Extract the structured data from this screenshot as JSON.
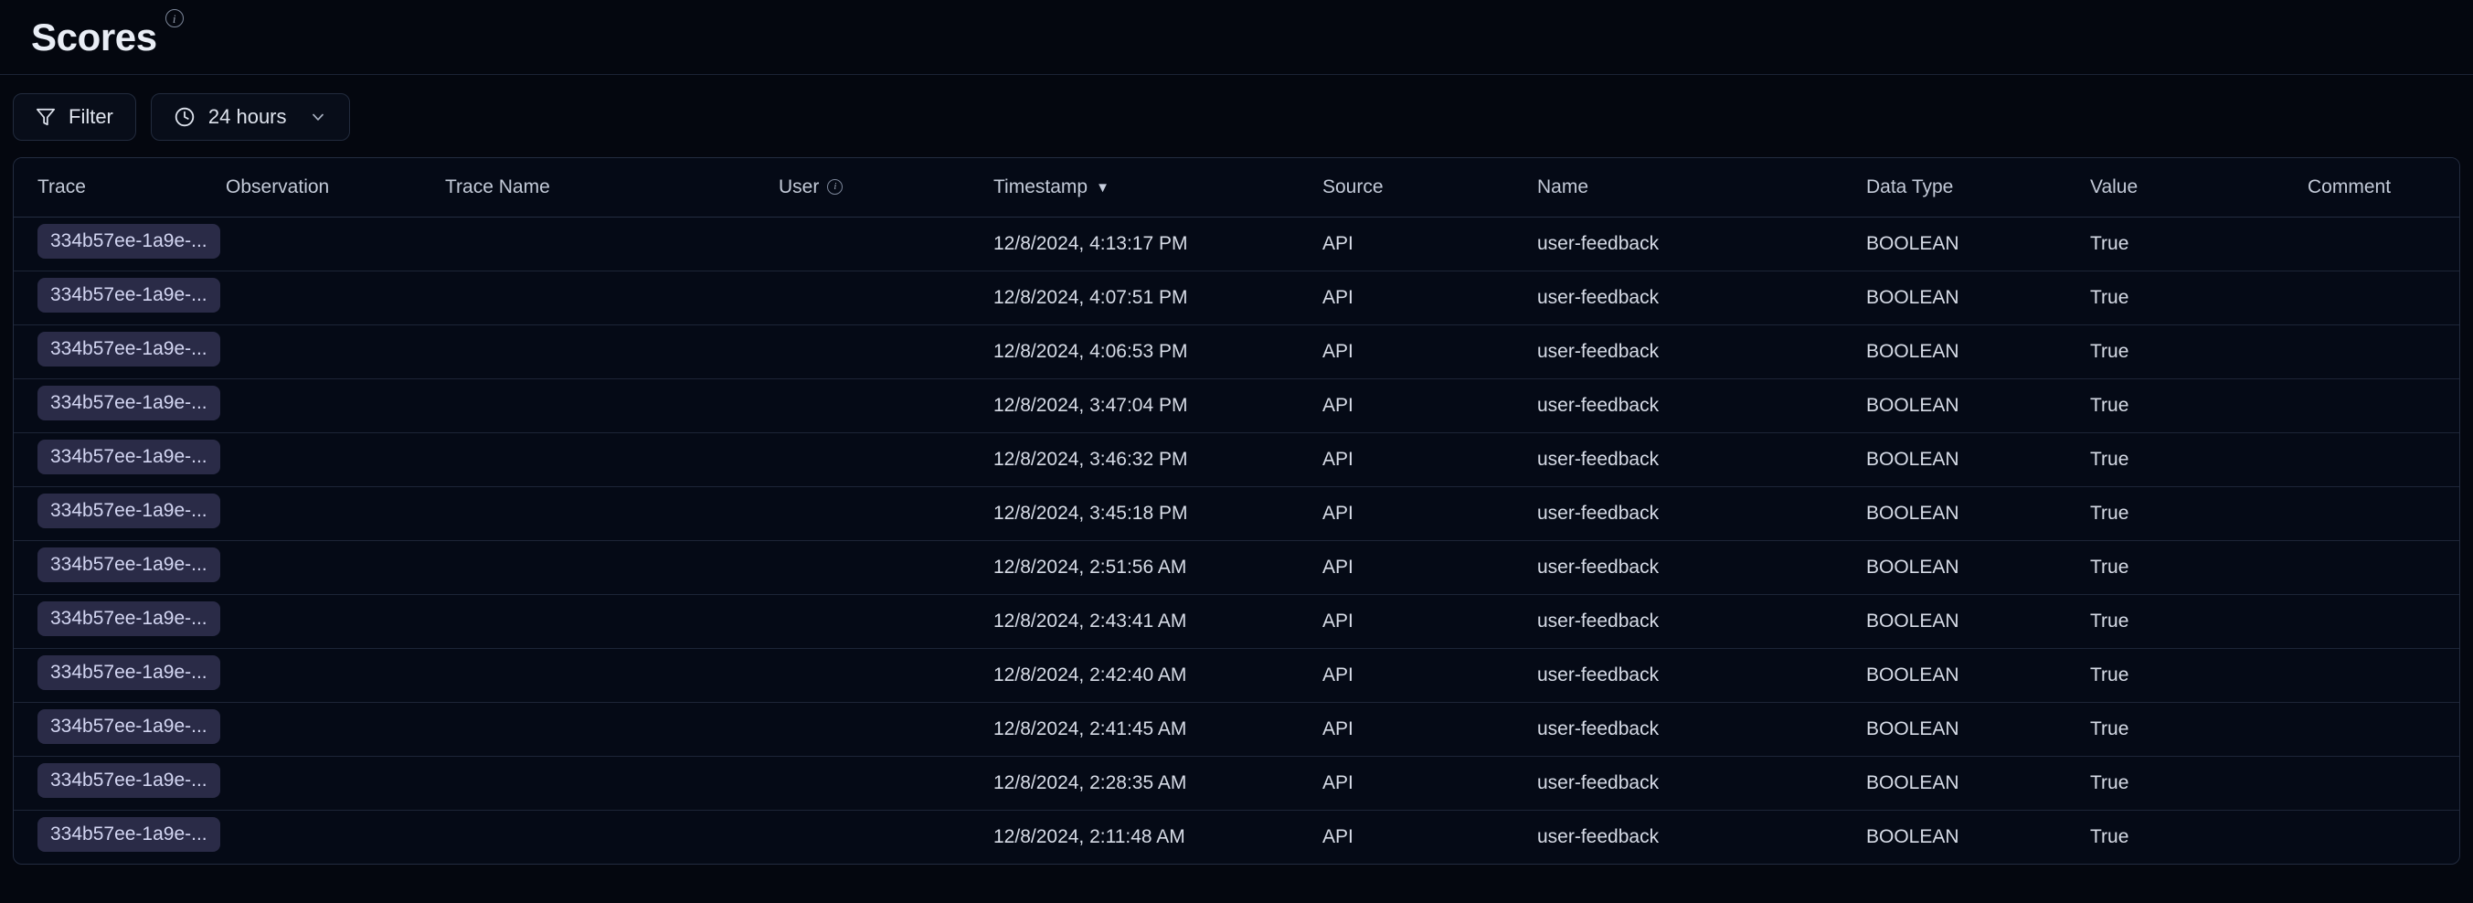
{
  "header": {
    "title": "Scores",
    "info_icon": "info-icon"
  },
  "toolbar": {
    "filter_label": "Filter",
    "filter_icon": "funnel-icon",
    "time_range_label": "24 hours",
    "time_range_icon": "clock-icon",
    "chevron_icon": "chevron-down-icon"
  },
  "table": {
    "columns": [
      {
        "key": "trace",
        "label": "Trace"
      },
      {
        "key": "observation",
        "label": "Observation"
      },
      {
        "key": "trace_name",
        "label": "Trace Name"
      },
      {
        "key": "user",
        "label": "User",
        "info_icon": "info-icon"
      },
      {
        "key": "timestamp",
        "label": "Timestamp",
        "sort": "desc",
        "sort_icon": "caret-down-icon"
      },
      {
        "key": "source",
        "label": "Source"
      },
      {
        "key": "name",
        "label": "Name"
      },
      {
        "key": "data_type",
        "label": "Data Type"
      },
      {
        "key": "value",
        "label": "Value"
      },
      {
        "key": "comment",
        "label": "Comment"
      }
    ],
    "rows": [
      {
        "trace": "334b57ee-1a9e-...",
        "observation": "",
        "trace_name": "",
        "user": "",
        "timestamp": "12/8/2024, 4:13:17 PM",
        "source": "API",
        "name": "user-feedback",
        "data_type": "BOOLEAN",
        "value": "True",
        "comment": ""
      },
      {
        "trace": "334b57ee-1a9e-...",
        "observation": "",
        "trace_name": "",
        "user": "",
        "timestamp": "12/8/2024, 4:07:51 PM",
        "source": "API",
        "name": "user-feedback",
        "data_type": "BOOLEAN",
        "value": "True",
        "comment": ""
      },
      {
        "trace": "334b57ee-1a9e-...",
        "observation": "",
        "trace_name": "",
        "user": "",
        "timestamp": "12/8/2024, 4:06:53 PM",
        "source": "API",
        "name": "user-feedback",
        "data_type": "BOOLEAN",
        "value": "True",
        "comment": ""
      },
      {
        "trace": "334b57ee-1a9e-...",
        "observation": "",
        "trace_name": "",
        "user": "",
        "timestamp": "12/8/2024, 3:47:04 PM",
        "source": "API",
        "name": "user-feedback",
        "data_type": "BOOLEAN",
        "value": "True",
        "comment": ""
      },
      {
        "trace": "334b57ee-1a9e-...",
        "observation": "",
        "trace_name": "",
        "user": "",
        "timestamp": "12/8/2024, 3:46:32 PM",
        "source": "API",
        "name": "user-feedback",
        "data_type": "BOOLEAN",
        "value": "True",
        "comment": ""
      },
      {
        "trace": "334b57ee-1a9e-...",
        "observation": "",
        "trace_name": "",
        "user": "",
        "timestamp": "12/8/2024, 3:45:18 PM",
        "source": "API",
        "name": "user-feedback",
        "data_type": "BOOLEAN",
        "value": "True",
        "comment": ""
      },
      {
        "trace": "334b57ee-1a9e-...",
        "observation": "",
        "trace_name": "",
        "user": "",
        "timestamp": "12/8/2024, 2:51:56 AM",
        "source": "API",
        "name": "user-feedback",
        "data_type": "BOOLEAN",
        "value": "True",
        "comment": ""
      },
      {
        "trace": "334b57ee-1a9e-...",
        "observation": "",
        "trace_name": "",
        "user": "",
        "timestamp": "12/8/2024, 2:43:41 AM",
        "source": "API",
        "name": "user-feedback",
        "data_type": "BOOLEAN",
        "value": "True",
        "comment": ""
      },
      {
        "trace": "334b57ee-1a9e-...",
        "observation": "",
        "trace_name": "",
        "user": "",
        "timestamp": "12/8/2024, 2:42:40 AM",
        "source": "API",
        "name": "user-feedback",
        "data_type": "BOOLEAN",
        "value": "True",
        "comment": ""
      },
      {
        "trace": "334b57ee-1a9e-...",
        "observation": "",
        "trace_name": "",
        "user": "",
        "timestamp": "12/8/2024, 2:41:45 AM",
        "source": "API",
        "name": "user-feedback",
        "data_type": "BOOLEAN",
        "value": "True",
        "comment": ""
      },
      {
        "trace": "334b57ee-1a9e-...",
        "observation": "",
        "trace_name": "",
        "user": "",
        "timestamp": "12/8/2024, 2:28:35 AM",
        "source": "API",
        "name": "user-feedback",
        "data_type": "BOOLEAN",
        "value": "True",
        "comment": ""
      },
      {
        "trace": "334b57ee-1a9e-...",
        "observation": "",
        "trace_name": "",
        "user": "",
        "timestamp": "12/8/2024, 2:11:48 AM",
        "source": "API",
        "name": "user-feedback",
        "data_type": "BOOLEAN",
        "value": "True",
        "comment": ""
      }
    ]
  },
  "colors": {
    "background": "#04070f",
    "panel": "#050a16",
    "border": "#232c40",
    "text_primary": "#e9edf5",
    "text_secondary": "#c3cad8",
    "chip_bg": "#2a2b47",
    "chip_text": "#d3d6f2"
  }
}
